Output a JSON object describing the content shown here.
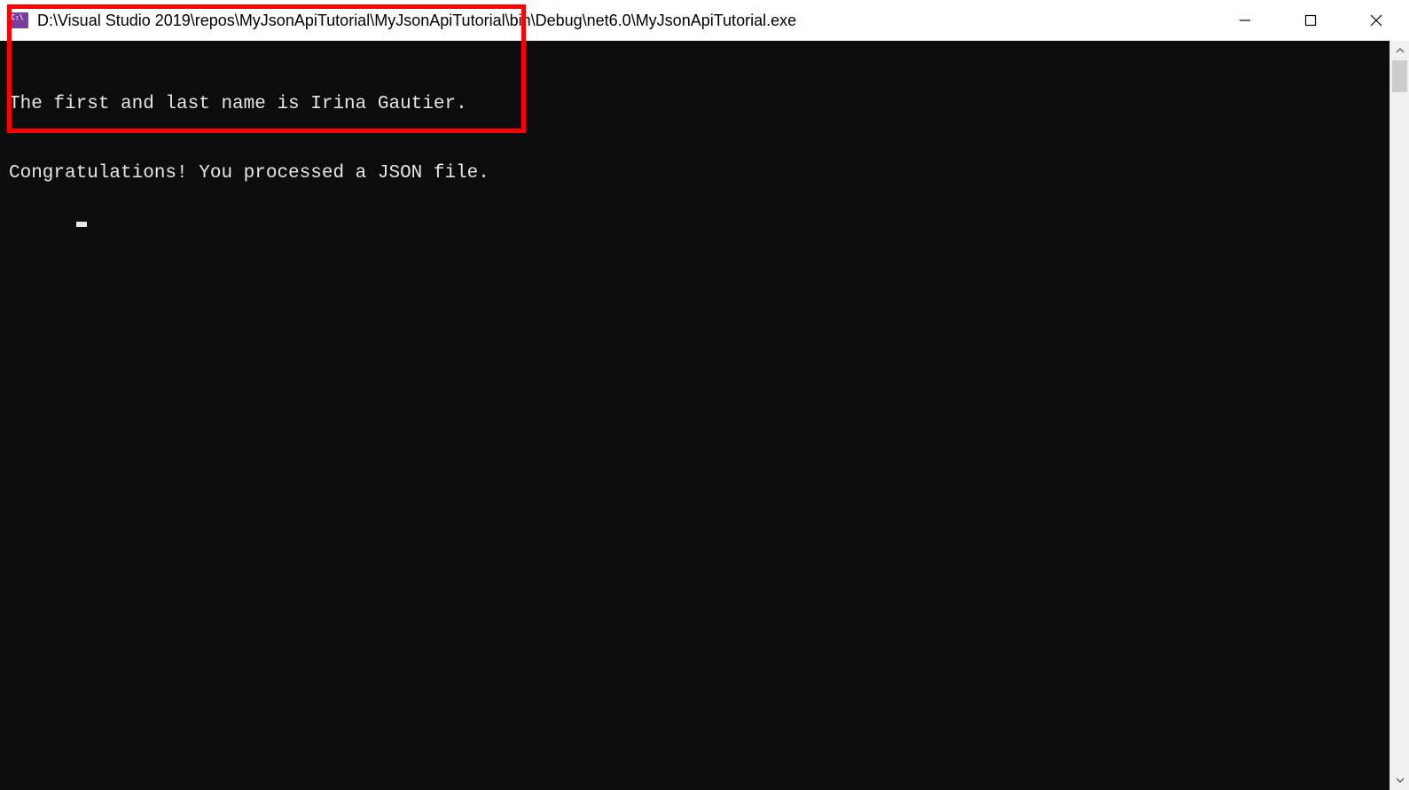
{
  "titlebar": {
    "title": "D:\\Visual Studio 2019\\repos\\MyJsonApiTutorial\\MyJsonApiTutorial\\bin\\Debug\\net6.0\\MyJsonApiTutorial.exe"
  },
  "console": {
    "lines": [
      "The first and last name is Irina Gautier.",
      "Congratulations! You processed a JSON file."
    ]
  },
  "colors": {
    "console_bg": "#0c0c0c",
    "console_fg": "#e6e6e6",
    "highlight": "#ff0000",
    "titlebar_bg": "#ffffff"
  }
}
